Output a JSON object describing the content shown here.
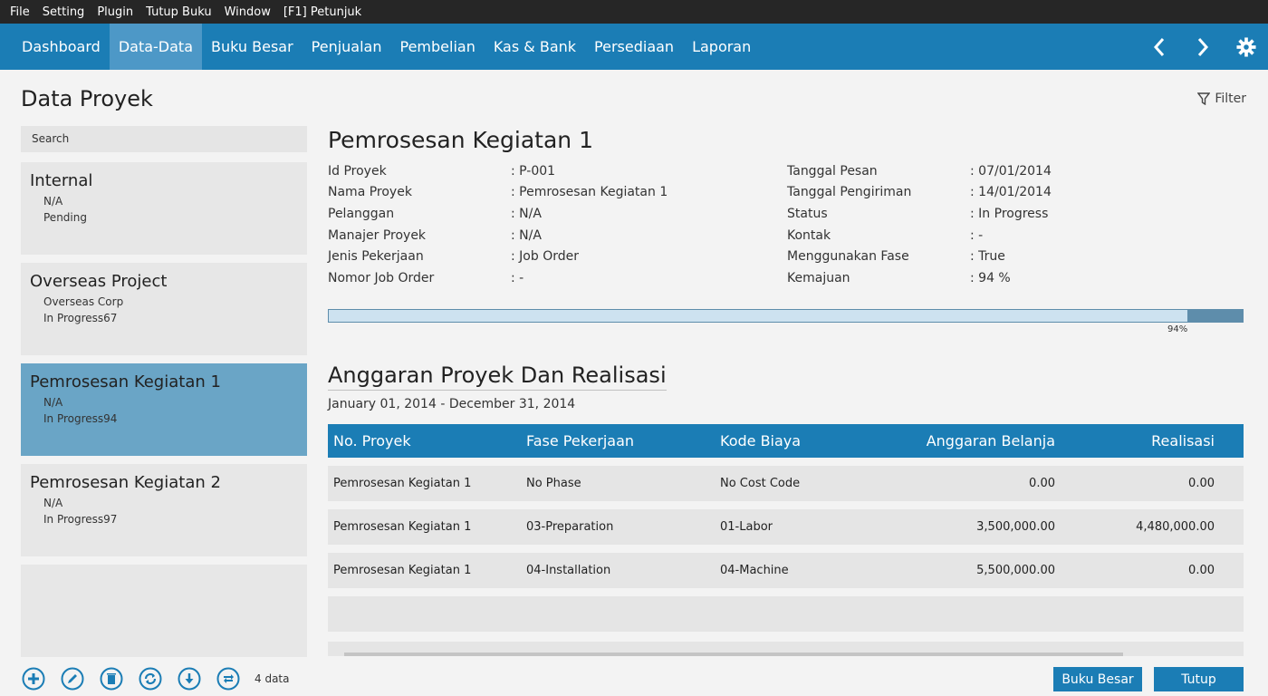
{
  "menu": [
    "File",
    "Setting",
    "Plugin",
    "Tutup Buku",
    "Window",
    "[F1] Petunjuk"
  ],
  "nav": {
    "items": [
      {
        "label": "Dashboard",
        "active": false
      },
      {
        "label": "Data-Data",
        "active": true
      },
      {
        "label": "Buku Besar",
        "active": false
      },
      {
        "label": "Penjualan",
        "active": false
      },
      {
        "label": "Pembelian",
        "active": false
      },
      {
        "label": "Kas & Bank",
        "active": false
      },
      {
        "label": "Persediaan",
        "active": false
      },
      {
        "label": "Laporan",
        "active": false
      }
    ],
    "icons": [
      "chevron-left-icon",
      "chevron-right-icon",
      "gear-icon"
    ]
  },
  "page": {
    "title": "Data Proyek",
    "filter_label": "Filter"
  },
  "search": {
    "placeholder": "Search"
  },
  "projects": [
    {
      "name": "Internal",
      "line1": "N/A",
      "line2": "Pending",
      "selected": false
    },
    {
      "name": "Overseas Project",
      "line1": "Overseas Corp",
      "line2": "In Progress67",
      "selected": false
    },
    {
      "name": "Pemrosesan Kegiatan 1",
      "line1": "N/A",
      "line2": "In Progress94",
      "selected": true
    },
    {
      "name": "Pemrosesan Kegiatan 2",
      "line1": "N/A",
      "line2": "In Progress97",
      "selected": false
    }
  ],
  "toolbar": {
    "icons": [
      "add-icon",
      "edit-icon",
      "delete-icon",
      "refresh-icon",
      "download-icon",
      "export-icon"
    ],
    "count": "4 data"
  },
  "detail": {
    "title": "Pemrosesan Kegiatan 1",
    "left": [
      {
        "label": "Id Proyek",
        "value": ":  P-001"
      },
      {
        "label": "Nama Proyek",
        "value": ":  Pemrosesan Kegiatan 1"
      },
      {
        "label": "Pelanggan",
        "value": ":  N/A"
      },
      {
        "label": "Manajer Proyek",
        "value": ":  N/A"
      },
      {
        "label": "Jenis Pekerjaan",
        "value": ":  Job Order"
      },
      {
        "label": "Nomor Job Order",
        "value": ":  -"
      }
    ],
    "right": [
      {
        "label": "Tanggal Pesan",
        "value": ":  07/01/2014"
      },
      {
        "label": "Tanggal Pengiriman",
        "value": ":  14/01/2014"
      },
      {
        "label": "Status",
        "value": ":  In Progress"
      },
      {
        "label": "Kontak",
        "value": ":  -"
      },
      {
        "label": "Menggunakan Fase",
        "value": ":  True"
      },
      {
        "label": "Kemajuan",
        "value": ":  94 %"
      }
    ],
    "progress": 0.94,
    "progress_label": "94%"
  },
  "budget": {
    "title": "Anggaran Proyek Dan Realisasi",
    "date_range": "January 01, 2014 - December 31, 2014",
    "columns": [
      "No. Proyek",
      "Fase Pekerjaan",
      "Kode Biaya",
      "Anggaran Belanja",
      "Realisasi"
    ],
    "rows": [
      [
        "Pemrosesan Kegiatan 1",
        "No Phase",
        "No Cost Code",
        "0.00",
        "0.00"
      ],
      [
        "Pemrosesan Kegiatan 1",
        "03-Preparation",
        "01-Labor",
        "3,500,000.00",
        "4,480,000.00"
      ],
      [
        "Pemrosesan Kegiatan 1",
        "04-Installation",
        "04-Machine",
        "5,500,000.00",
        "0.00"
      ]
    ]
  },
  "buttons": {
    "ledger": "Buku Besar",
    "close": "Tutup"
  },
  "colors": {
    "accent": "#1b7db5",
    "selected": "#6aa5c6",
    "menubar": "#262626"
  }
}
